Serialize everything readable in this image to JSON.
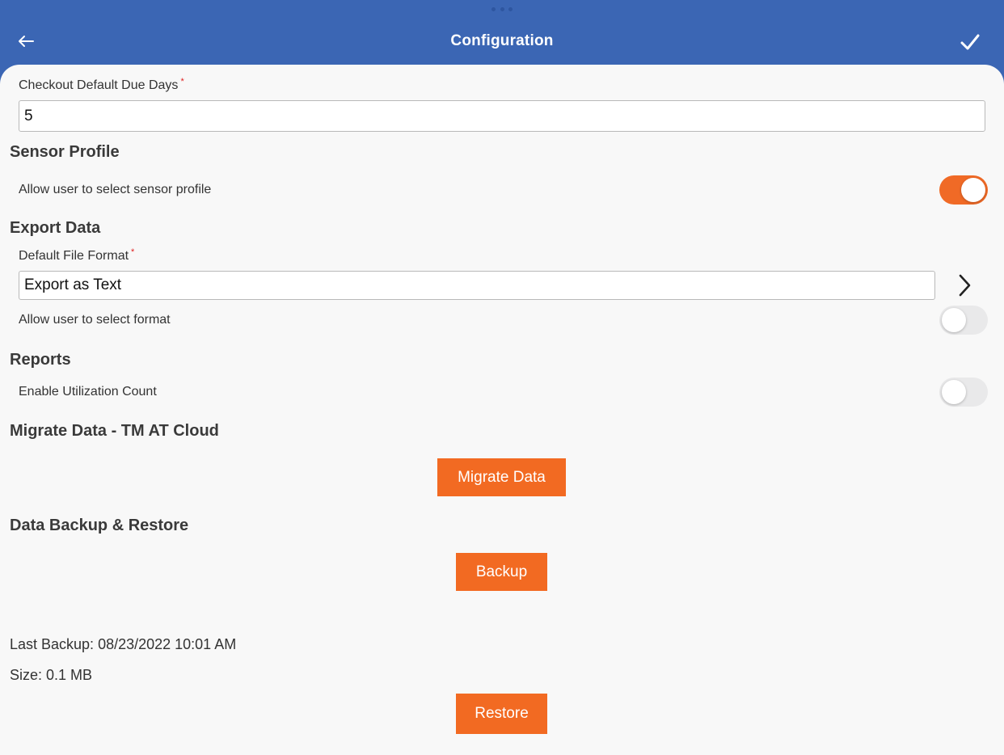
{
  "header": {
    "title": "Configuration",
    "back_icon": "arrow-left-icon",
    "done_icon": "checkmark-icon"
  },
  "checkout": {
    "label": "Checkout Default Due Days",
    "required_mark": "*",
    "value": "5"
  },
  "sensor_profile": {
    "title": "Sensor Profile",
    "allow_label": "Allow user to select sensor profile",
    "allow_on": true
  },
  "export_data": {
    "title": "Export Data",
    "format_label": "Default File Format",
    "required_mark": "*",
    "format_value": "Export as Text",
    "allow_label": "Allow user to select format",
    "allow_on": false
  },
  "reports": {
    "title": "Reports",
    "utilization_label": "Enable Utilization Count",
    "utilization_on": false
  },
  "migrate": {
    "title": "Migrate Data - TM AT Cloud",
    "button_label": "Migrate Data"
  },
  "backup": {
    "title": "Data Backup & Restore",
    "backup_label": "Backup",
    "last_backup": "Last Backup: 08/23/2022 10:01 AM",
    "size": "Size: 0.1 MB",
    "restore_label": "Restore"
  },
  "colors": {
    "header": "#3b66b4",
    "accent": "#f26a22",
    "toggle_on": "#f06a26",
    "toggle_off": "#e9e9ea"
  }
}
